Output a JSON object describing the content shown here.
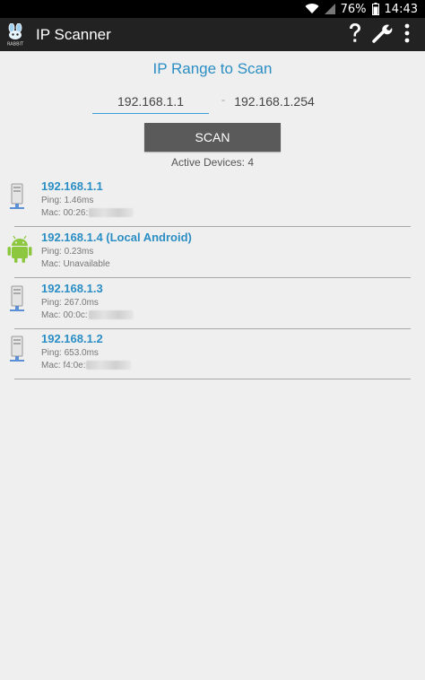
{
  "status_bar": {
    "battery": "76%",
    "time": "14:43"
  },
  "action_bar": {
    "logo_text": "RABBIT",
    "title": "IP Scanner",
    "icons": [
      "help-icon",
      "settings-wrench-icon",
      "overflow-menu-icon"
    ]
  },
  "range": {
    "title": "IP Range to Scan",
    "start": "192.168.1.1",
    "separator": "-",
    "end": "192.168.1.254"
  },
  "scan": {
    "button_label": "SCAN",
    "active_devices": "Active Devices: 4"
  },
  "devices": [
    {
      "ip": "192.168.1.1",
      "ping": "Ping: 1.46ms",
      "mac": "Mac: 00:26:",
      "icon": "network-device-icon"
    },
    {
      "ip": "192.168.1.4 (Local Android)",
      "ping": "Ping: 0.23ms",
      "mac": "Mac: Unavailable",
      "icon": "android-icon"
    },
    {
      "ip": "192.168.1.3",
      "ping": "Ping: 267.0ms",
      "mac": "Mac: 00:0c:",
      "icon": "network-device-icon"
    },
    {
      "ip": "192.168.1.2",
      "ping": "Ping: 653.0ms",
      "mac": "Mac: f4:0e:",
      "icon": "network-device-icon"
    }
  ],
  "colors": {
    "accent": "#2b8ec4",
    "action_bar": "#222222",
    "scan_button": "#5a5a5a",
    "background": "#efefef",
    "android_green": "#8dc63f"
  }
}
